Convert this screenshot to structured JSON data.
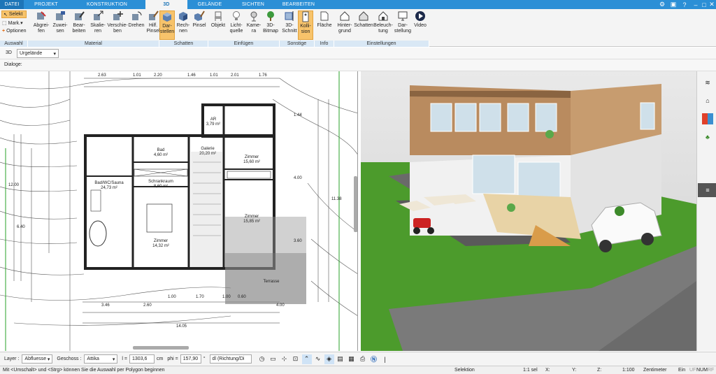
{
  "tabs": [
    {
      "label": "DATEI"
    },
    {
      "label": "PROJEKT"
    },
    {
      "label": "KONSTRUKTION"
    },
    {
      "label": "3D"
    },
    {
      "label": "GELÄNDE"
    },
    {
      "label": "SICHTEN"
    },
    {
      "label": "BEARBEITEN"
    }
  ],
  "selection": {
    "selekt": "Selekt",
    "mark": "Mark.",
    "optionen": "Optionen",
    "group": "Auswahl"
  },
  "ribbon": {
    "material": [
      "Abgrei-\nfen",
      "Zuwei-\nsen",
      "Bear-\nbeiten",
      "Skalie-\nren",
      "Verschie-\nben",
      "Drehen",
      "Hilf.\nPinsel"
    ],
    "schatten": [
      "Dar-\nstellen",
      "Rech-\nnen",
      "Pinsel"
    ],
    "einfuegen": [
      "Objekt",
      "Licht-\nquelle",
      "Kame-\nra",
      "3D-\nBitmap"
    ],
    "sonstige": [
      "3D-\nSchnitt",
      "Kolli-\nsion"
    ],
    "info": [
      "Fläche"
    ],
    "einstellungen": [
      "Hinter-\ngrund",
      "Schatten",
      "Beleuch-\ntung",
      "Dar-\nstellung",
      "Video"
    ],
    "groups": {
      "material": "Material",
      "schatten": "Schatten",
      "einfuegen": "Einfügen",
      "sonstige": "Sonstige",
      "info": "Info",
      "einstellungen": "Einstellungen"
    }
  },
  "toolbar2": {
    "mode": "3D",
    "dropdown": "Urgelände"
  },
  "toolbar3": {
    "dialoge": "Dialoge:"
  },
  "plan": {
    "rooms": [
      {
        "name": "Bad/WC/Sauna",
        "area": "24,73 m²"
      },
      {
        "name": "Bad",
        "area": "4,60 m²"
      },
      {
        "name": "Schrankraum",
        "area": "8,60 m²"
      },
      {
        "name": "Zimmer",
        "area": "14,32 m²"
      },
      {
        "name": "Galerie",
        "area": "20,20 m²"
      },
      {
        "name": "Zimmer",
        "area": "15,60 m²"
      },
      {
        "name": "Zimmer",
        "area": "15,85 m²"
      },
      {
        "name": "AR",
        "area": "3,79 m²"
      },
      {
        "name": "Terrasse",
        "area": ""
      }
    ],
    "top_dims": [
      "2.63",
      "1.01",
      "2.20",
      "1.46",
      "1.01",
      "2.01",
      "1.76"
    ],
    "bottom_dims": [
      "3.46",
      "2.60",
      "1.00",
      "1.70",
      "1.00",
      "0.60",
      "4.00"
    ],
    "total_dim": "14.05",
    "left_dims": [
      "12.00",
      "6.40"
    ],
    "right_dims": [
      "1.44",
      "4.00",
      "3.60",
      "11.38"
    ]
  },
  "bottombar": {
    "layer_label": "Layer :",
    "layer_value": "Abfluesse",
    "geschoss_label": "Geschoss :",
    "geschoss_value": "Attika",
    "l_label": "l =",
    "l_value": "1303,6",
    "unit": "cm",
    "phi_label": "phi =",
    "phi_value": "157,90",
    "deg": "°",
    "direction": "dl (Richtung/Di"
  },
  "status": {
    "hint": "Mit <Umschalt> und <Strg> können Sie die Auswahl per Polygon beginnen",
    "mode": "Selektion",
    "sel": "1:1 sel",
    "x": "X:",
    "y": "Y:",
    "z": "Z:",
    "scale": "1:100",
    "unit": "Zentimeter",
    "ein": "Ein",
    "flags": [
      "UF",
      "NUM",
      "RF"
    ]
  },
  "colors": {
    "accent": "#2b8fd6",
    "active_btn": "#f7c36b",
    "grass": "#4c9b2c"
  }
}
